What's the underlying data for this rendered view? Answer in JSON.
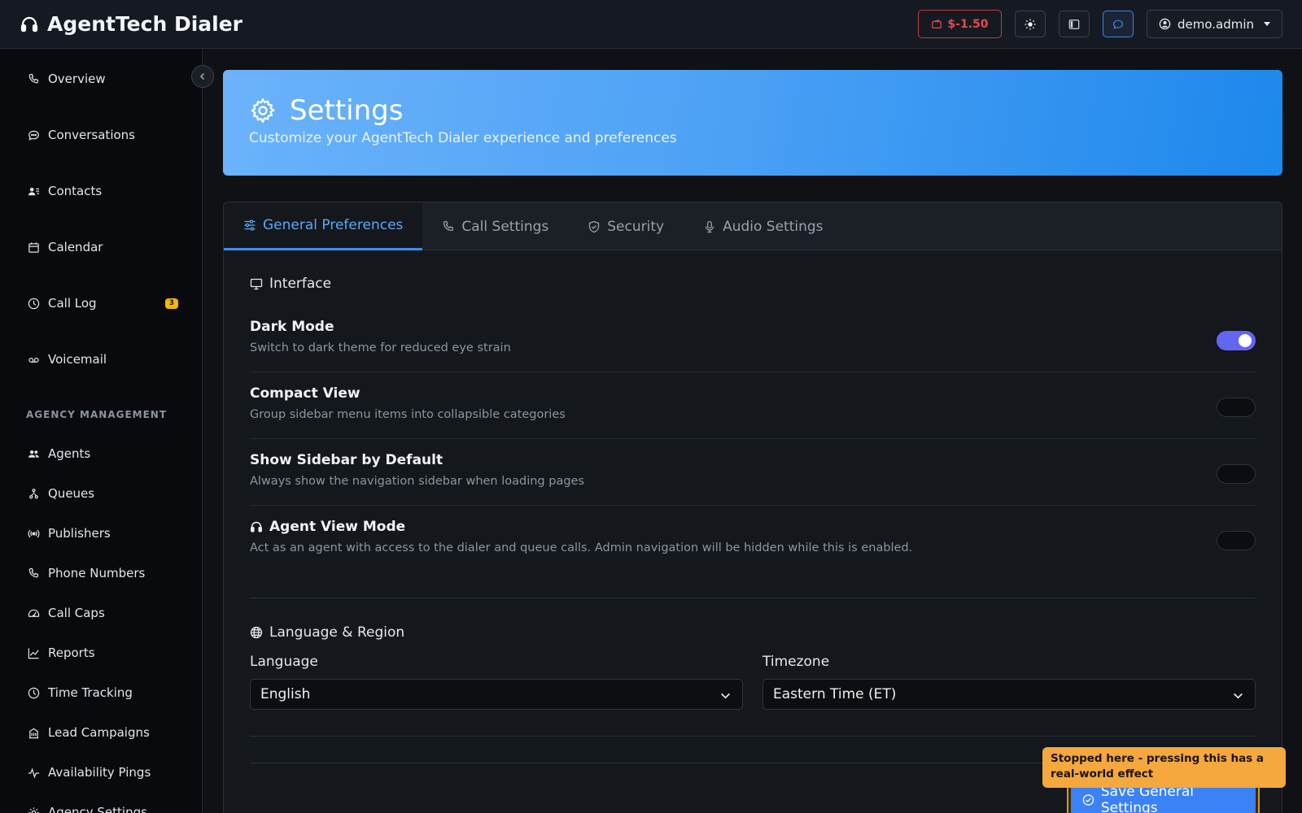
{
  "app": {
    "title": "AgentTech Dialer"
  },
  "topbar": {
    "balance": "$-1.50",
    "user": "demo.admin"
  },
  "sidebar": {
    "items": [
      {
        "label": "Overview",
        "icon": "phone-icon"
      },
      {
        "label": "Conversations",
        "icon": "chat-icon"
      },
      {
        "label": "Contacts",
        "icon": "contacts-icon"
      },
      {
        "label": "Calendar",
        "icon": "calendar-icon"
      },
      {
        "label": "Call Log",
        "icon": "clock-icon",
        "badge": "3"
      },
      {
        "label": "Voicemail",
        "icon": "voicemail-icon"
      }
    ],
    "section_label": "AGENCY MANAGEMENT",
    "agency_items": [
      {
        "label": "Agents",
        "icon": "people-icon"
      },
      {
        "label": "Queues",
        "icon": "queues-icon"
      },
      {
        "label": "Publishers",
        "icon": "broadcast-icon"
      },
      {
        "label": "Phone Numbers",
        "icon": "phone-icon"
      },
      {
        "label": "Call Caps",
        "icon": "gauge-icon"
      },
      {
        "label": "Reports",
        "icon": "chart-icon"
      },
      {
        "label": "Time Tracking",
        "icon": "clock-icon"
      },
      {
        "label": "Lead Campaigns",
        "icon": "building-icon"
      },
      {
        "label": "Availability Pings",
        "icon": "pulse-icon"
      },
      {
        "label": "Agency Settings",
        "icon": "gear-icon"
      }
    ]
  },
  "hero": {
    "title": "Settings",
    "subtitle": "Customize your AgentTech Dialer experience and preferences"
  },
  "tabs": [
    {
      "label": "General Preferences",
      "active": true
    },
    {
      "label": "Call Settings",
      "active": false
    },
    {
      "label": "Security",
      "active": false
    },
    {
      "label": "Audio Settings",
      "active": false
    }
  ],
  "interface": {
    "heading": "Interface",
    "settings": [
      {
        "title": "Dark Mode",
        "desc": "Switch to dark theme for reduced eye strain",
        "on": true
      },
      {
        "title": "Compact View",
        "desc": "Group sidebar menu items into collapsible categories",
        "on": false
      },
      {
        "title": "Show Sidebar by Default",
        "desc": "Always show the navigation sidebar when loading pages",
        "on": false
      },
      {
        "title": "Agent View Mode",
        "desc": "Act as an agent with access to the dialer and queue calls. Admin navigation will be hidden while this is enabled.",
        "on": false
      }
    ]
  },
  "language_region": {
    "heading": "Language & Region",
    "language_label": "Language",
    "language_value": "English",
    "timezone_label": "Timezone",
    "timezone_value": "Eastern Time (ET)"
  },
  "save_button": "Save General Settings",
  "tooltip": "Stopped here - pressing this has a real-world effect",
  "colors": {
    "accent": "#3b82f6",
    "toggle_on": "#6366f1",
    "warning": "#f4a83d",
    "danger": "#e24a52"
  }
}
